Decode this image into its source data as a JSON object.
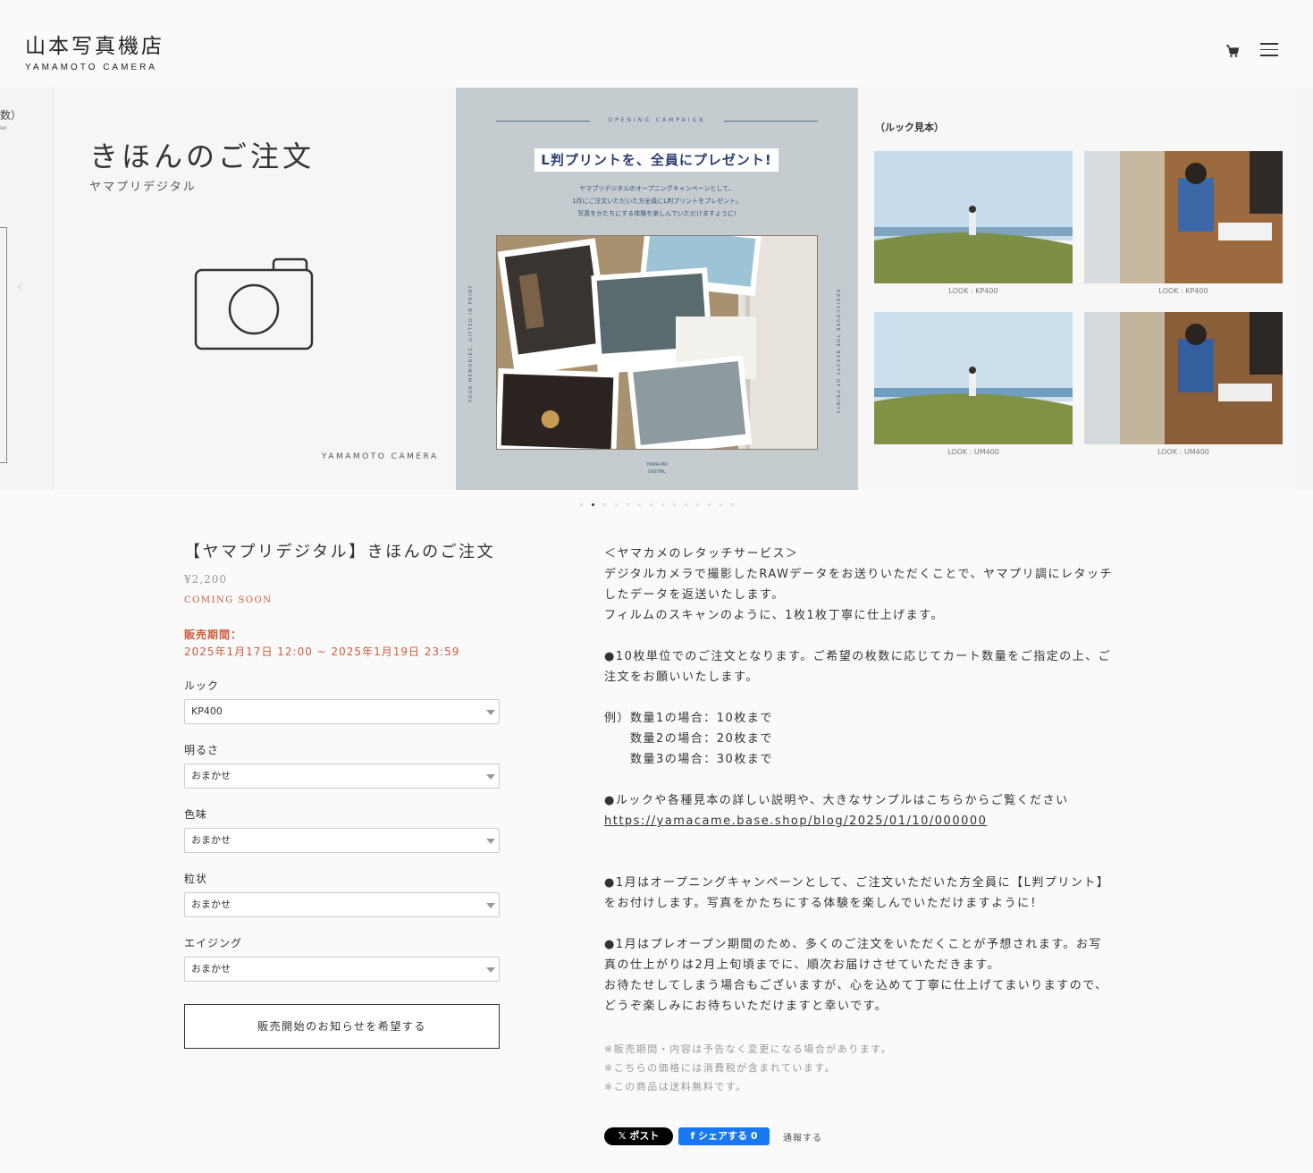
{
  "header": {
    "logo_jp": "山本写真機店",
    "logo_en": "YAMAMOTO CAMERA",
    "cart_icon": "cart-icon",
    "menu_icon": "hamburger-menu-icon"
  },
  "slider": {
    "left_fragment": "数）",
    "left_fragment2": "ier",
    "slide1": {
      "title": "きほんのご注文",
      "subtitle": "ヤマプリデジタル",
      "brand": "YAMAMOTO CAMERA"
    },
    "slide2": {
      "campaign": "OPENING CAMPAIGN",
      "banner": "L判プリントを、全員にプレゼント!",
      "text": [
        "ヤマプリデジタルのオープニングキャンペーンとして、",
        "1月にご注文いただいた方全員にL判プリントをプレゼント。",
        "写真をかたちにする体験を楽しんでいただけますように!"
      ],
      "side_left": "YOUR MEMORIES, GIFTED IN PRINT",
      "side_right": "REDISCOVER THE BEAUTY OF PRINTS",
      "foot": [
        "YAMA-PRI",
        "DIGITAL"
      ]
    },
    "slide3": {
      "title": "（ルック見本）",
      "captions": [
        "LOOK : KP400",
        "LOOK : KP400",
        "LOOK : UM400",
        "LOOK : UM400"
      ]
    },
    "dots_count": 14,
    "active_dot": 1
  },
  "product": {
    "title": "【ヤマプリデジタル】きほんのご注文",
    "price": "¥2,200",
    "status": "COMING SOON",
    "period_label": "販売期間：",
    "period": "2025年1月17日 12:00 ~ 2025年1月19日 23:59",
    "options": [
      {
        "label": "ルック",
        "value": "KP400"
      },
      {
        "label": "明るさ",
        "value": "おまかせ"
      },
      {
        "label": "色味",
        "value": "おまかせ"
      },
      {
        "label": "粒状",
        "value": "おまかせ"
      },
      {
        "label": "エイジング",
        "value": "おまかせ"
      }
    ],
    "notify_button": "販売開始のお知らせを希望する"
  },
  "description": {
    "lines": [
      "＜ヤマカメのレタッチサービス＞",
      "デジタルカメラで撮影したRAWデータをお送りいただくことで、ヤマプリ調にレタッチ",
      "したデータを返送いたします。",
      "フィルムのスキャンのように、1枚1枚丁寧に仕上げます。",
      "",
      "●10枚単位でのご注文となります。ご希望の枚数に応じてカート数量をご指定の上、ご",
      "注文をお願いいたします。",
      "",
      "例）数量1の場合：10枚まで",
      "　　数量2の場合：20枚まで",
      "　　数量3の場合：30枚まで",
      "",
      "●ルックや各種見本の詳しい説明や、大きなサンプルはこちらからご覧ください"
    ],
    "link": "https://yamacame.base.shop/blog/2025/01/10/000000",
    "lines2": [
      "",
      "",
      "●1月はオープニングキャンペーンとして、ご注文いただいた方全員に【L判プリント】",
      "をお付けします。写真をかたちにする体験を楽しんでいただけますように！",
      "",
      "●1月はプレオープン期間のため、多くのご注文をいただくことが予想されます。お写",
      "真の仕上がりは2月上旬頃までに、順次お届けさせていただきます。",
      "お待たせしてしまう場合もございますが、心を込めて丁寧に仕上げてまいりますので、",
      "どうぞ楽しみにお待ちいただけますと幸いです。"
    ],
    "notes": [
      "※販売期間・内容は予告なく変更になる場合があります。",
      "※こちらの価格には消費税が含まれています。",
      "※この商品は送料無料です。"
    ]
  },
  "share": {
    "x_label": "𝕏 ポスト",
    "fb_label": "f シェアする 0",
    "report_label": "通報する"
  }
}
